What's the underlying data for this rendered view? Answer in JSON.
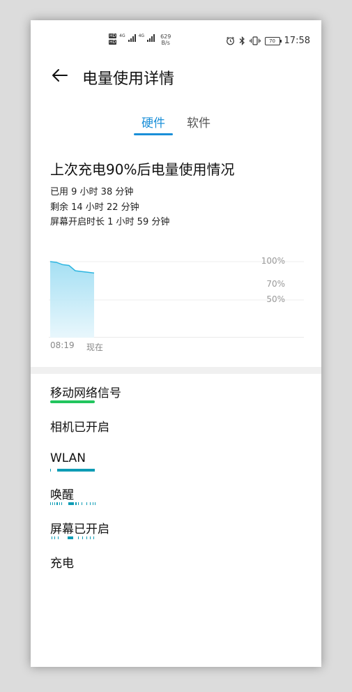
{
  "status_bar": {
    "hd1": "HD",
    "hd2": "HD",
    "net1": "4G",
    "net2": "4G",
    "speed_value": "629",
    "speed_unit": "B/s",
    "battery": "70",
    "time": "17:58"
  },
  "header": {
    "title": "电量使用详情"
  },
  "tabs": [
    {
      "label": "硬件",
      "active": true
    },
    {
      "label": "软件",
      "active": false
    }
  ],
  "summary": {
    "title": "上次充电90%后电量使用情况",
    "used": "已用 9 小时 38 分钟",
    "remaining": "剩余 14 小时 22 分钟",
    "screen_on": "屏幕开启时长 1 小时 59 分钟"
  },
  "chart_data": {
    "type": "area",
    "y_ticks": [
      "100%",
      "70%",
      "50%"
    ],
    "x_labels": [
      "08:19",
      "现在"
    ],
    "values": [
      100,
      99,
      96,
      95,
      88,
      87,
      86,
      85
    ],
    "ylim": [
      0,
      100
    ],
    "color": "#2db5e0"
  },
  "hardware_items": [
    {
      "label": "移动网络信号",
      "bar_color": "#22c55e"
    },
    {
      "label": "相机已开启",
      "bar_color": ""
    },
    {
      "label": "WLAN",
      "bar_color": "#0e9cb5"
    },
    {
      "label": "唤醒",
      "bar_color": "#0e9cb5"
    },
    {
      "label": "屏幕已开启",
      "bar_color": "#0e9cb5"
    },
    {
      "label": "充电",
      "bar_color": ""
    }
  ]
}
